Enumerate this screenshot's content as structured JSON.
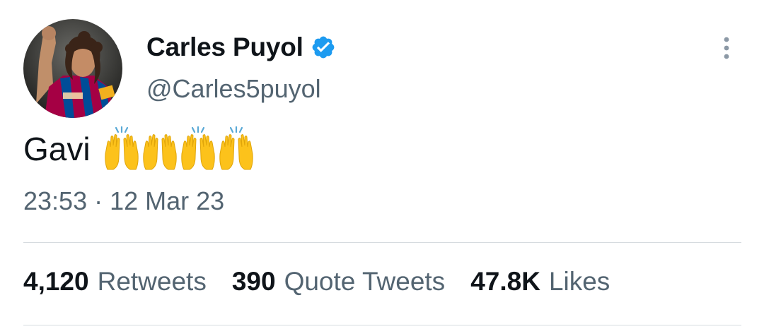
{
  "tweet": {
    "author": {
      "display_name": "Carles Puyol",
      "handle": "@Carles5puyol",
      "verified": true,
      "verified_color": "#1d9bf0",
      "avatar_icon": "profile-photo"
    },
    "more_icon": "vertical-ellipsis-icon",
    "text": "Gavi",
    "emojis": [
      "raising-hands",
      "raising-hands",
      "raising-hands",
      "raising-hands"
    ],
    "time": "23:53",
    "separator": "·",
    "date": "12 Mar 23",
    "stats": {
      "retweets": {
        "count": "4,120",
        "label": "Retweets"
      },
      "quotes": {
        "count": "390",
        "label": "Quote Tweets"
      },
      "likes": {
        "count": "47.8K",
        "label": "Likes"
      }
    }
  },
  "colors": {
    "primary_text": "#0f1419",
    "secondary_text": "#536471",
    "divider": "#d6dbdf",
    "emoji_yellow": "#fcc21b"
  }
}
